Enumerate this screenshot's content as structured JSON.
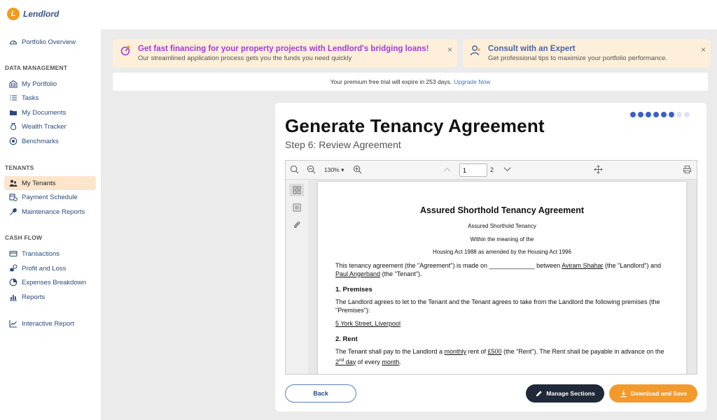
{
  "app": {
    "name": "Lendlord",
    "logo_letter": "L"
  },
  "sidebar": {
    "top_item": {
      "label": "Portfolio Overview",
      "icon": "gauge-icon"
    },
    "sections": [
      {
        "title": "DATA MANAGEMENT",
        "items": [
          {
            "label": "My Portfolio",
            "icon": "building-icon"
          },
          {
            "label": "Tasks",
            "icon": "list-icon"
          },
          {
            "label": "My Documents",
            "icon": "folder-icon"
          },
          {
            "label": "Wealth Tracker",
            "icon": "moneybag-icon"
          },
          {
            "label": "Benchmarks",
            "icon": "target-icon"
          }
        ]
      },
      {
        "title": "TENANTS",
        "items": [
          {
            "label": "My Tenants",
            "icon": "people-icon",
            "active": true
          },
          {
            "label": "Payment Schedule",
            "icon": "calendar-icon"
          },
          {
            "label": "Maintenance Reports",
            "icon": "wrench-icon"
          }
        ]
      },
      {
        "title": "CASH FLOW",
        "items": [
          {
            "label": "Transactions",
            "icon": "card-icon"
          },
          {
            "label": "Profit and Loss",
            "icon": "coins-icon"
          },
          {
            "label": "Expenses Breakdown",
            "icon": "pie-icon"
          },
          {
            "label": "Reports",
            "icon": "report-icon"
          }
        ]
      }
    ],
    "bottom_item": {
      "label": "Interactive Report",
      "icon": "chart-icon"
    }
  },
  "promos": [
    {
      "title": "Get fast financing for your property projects with Lendlord's bridging loans!",
      "desc": "Our streamlined application process gets you the funds you need quickly",
      "icon": "rocket-icon",
      "close": "×"
    },
    {
      "title": "Consult with an Expert",
      "desc": "Get professional tips to maximize your portfolio performance.",
      "icon": "expert-icon",
      "close": "×"
    }
  ],
  "trial": {
    "text": "Your premium free trial will expire in 253 days.",
    "link": "Upgrade Now"
  },
  "wizard": {
    "title": "Generate Tenancy Agreement",
    "step": "Step 6: Review Agreement",
    "total_steps": 8,
    "current_step": 6,
    "colors": {
      "dot_active": "#3b5fc9",
      "dot_inactive": "#dce4f5"
    }
  },
  "viewer": {
    "zoom": "130%",
    "page_value": "1",
    "page_total": "2"
  },
  "document": {
    "title": "Assured Shorthold Tenancy Agreement",
    "sub1": "Assured Shorthold Tenancy",
    "sub2": "Within the meaning of the",
    "sub3": "Housing Act 1988 as amended by the Housing Act 1996",
    "intro_a": "This tenancy agreement (the \"Agreement\") is made on",
    "intro_blank": "_____________",
    "intro_b": "between",
    "landlord_name": "Aviram Shahar",
    "intro_c": "(the \"Landlord\") and",
    "tenant_name": "Paul Angerband",
    "intro_d": "(the \"Tenant\").",
    "h1": "1. Premises",
    "p1": "The Landlord agrees to let to the Tenant and the Tenant agrees to take from the Landlord the following premises (the \"Premises\"):",
    "address": "5 York Street, Liverpool",
    "h2": "2. Rent",
    "rent_a": "The Tenant shall pay to the Landlord a",
    "rent_period": "monthly",
    "rent_b": "rent of",
    "rent_amount": "£500",
    "rent_c": "(the \"Rent\"). The Rent shall be payable in advance on the",
    "rent_day": "2",
    "rent_day_sup": "nd",
    "rent_day_word": "day",
    "rent_d": "of every",
    "rent_every": "month",
    "rent_end": "."
  },
  "buttons": {
    "back": "Back",
    "manage": "Manage Sections",
    "download": "Download and Save"
  }
}
